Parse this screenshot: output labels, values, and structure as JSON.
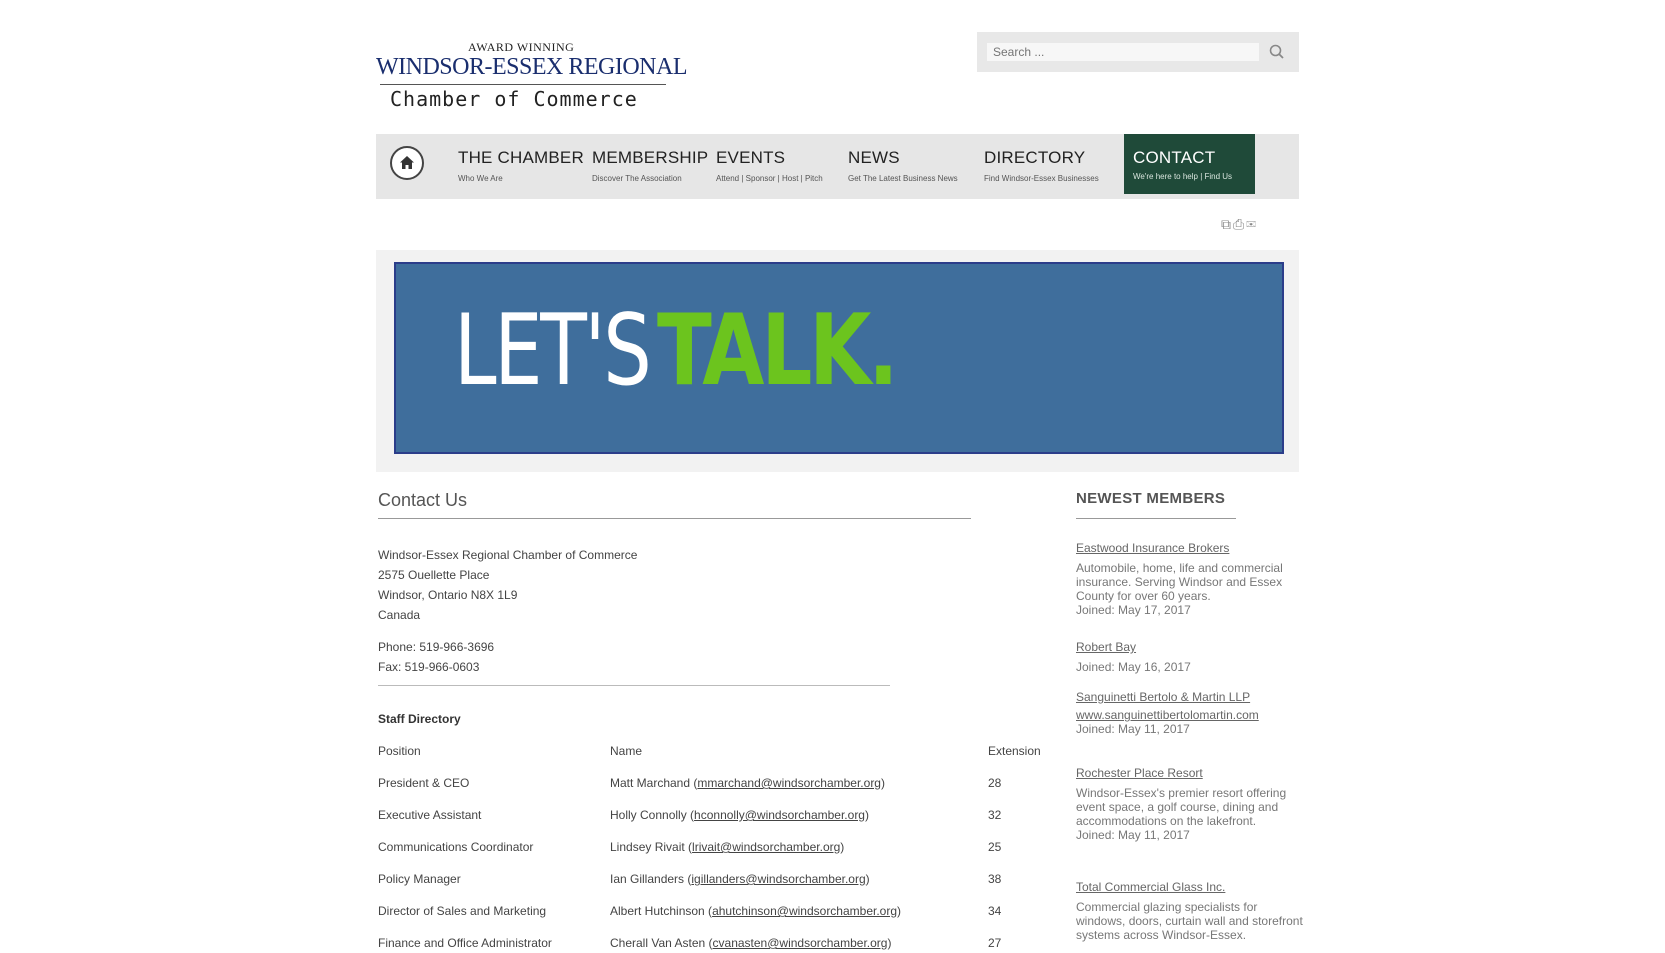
{
  "logo": {
    "award": "AWARD WINNING",
    "main": "WINDSOR-ESSEX REGIONAL",
    "sub": "Chamber of Commerce"
  },
  "search": {
    "placeholder": "Search ..."
  },
  "nav": {
    "items": [
      {
        "label": "THE CHAMBER",
        "sub": "Who We Are"
      },
      {
        "label": "MEMBERSHIP",
        "sub": "Discover The Association"
      },
      {
        "label": "EVENTS",
        "sub": "Attend | Sponsor | Host | Pitch"
      },
      {
        "label": "NEWS",
        "sub": "Get The Latest Business News"
      },
      {
        "label": "DIRECTORY",
        "sub": "Find Windsor-Essex Businesses"
      },
      {
        "label": "CONTACT",
        "sub": "We're here to help | Find Us"
      }
    ]
  },
  "banner": {
    "lets": "LET'S",
    "talk": "TALK."
  },
  "main": {
    "title": "Contact Us",
    "address": [
      "Windsor-Essex Regional Chamber of Commerce",
      "2575 Ouellette Place",
      "Windsor, Ontario N8X 1L9",
      "Canada"
    ],
    "phone": "Phone: 519-966-3696",
    "fax": "Fax: 519-966-0603",
    "staff_heading": "Staff Directory",
    "columns": [
      "Position",
      "Name",
      "Extension"
    ],
    "staff": [
      {
        "position": "President & CEO",
        "name": "Matt Marchand",
        "email": "mmarchand@windsorchamber.org",
        "ext": "28"
      },
      {
        "position": "Executive Assistant",
        "name": "Holly Connolly",
        "email": "hconnolly@windsorchamber.org",
        "ext": "32"
      },
      {
        "position": "Communications Coordinator",
        "name": "Lindsey Rivait",
        "email": "lrivait@windsorchamber.org",
        "ext": "25"
      },
      {
        "position": "Policy Manager",
        "name": "Ian Gillanders",
        "email": "igillanders@windsorchamber.org",
        "ext": "38"
      },
      {
        "position": "Director of Sales and Marketing",
        "name": "Albert Hutchinson",
        "email": "ahutchinson@windsorchamber.org",
        "ext": "34"
      },
      {
        "position": "Finance and Office Administrator",
        "name": "Cherall Van Asten",
        "email": "cvanasten@windsorchamber.org",
        "ext": "27"
      }
    ]
  },
  "sidebar": {
    "title": "NEWEST MEMBERS",
    "members": [
      {
        "name": "Eastwood Insurance Brokers",
        "desc": "Automobile, home, life and commercial insurance. Serving Windsor and Essex County for over 60 years.",
        "joined": "Joined: May 17, 2017"
      },
      {
        "name": "Robert Bay",
        "desc": "",
        "joined": "Joined: May 16, 2017"
      },
      {
        "name": "Sanguinetti Bertolo & Martin LLP",
        "desc": "www.sanguinettibertolomartin.com",
        "joined": "Joined: May 11, 2017"
      },
      {
        "name": "Rochester Place Resort",
        "desc": "Windsor-Essex's premier resort offering event space, a golf course, dining and accommodations on the lakefront.",
        "joined": "Joined: May 11, 2017"
      },
      {
        "name": "Total Commercial Glass Inc.",
        "desc": "Commercial glazing specialists for windows, doors, curtain wall and storefront systems across Windsor-Essex.",
        "joined": ""
      }
    ]
  },
  "colors": {
    "nav_active": "#1f4a39",
    "banner_bg": "#3f6e9c",
    "banner_accent": "#6cc41e",
    "logo_blue": "#1a2e6e"
  },
  "icons": [
    "search-icon",
    "home-icon",
    "share-icon",
    "print-icon",
    "email-icon"
  ]
}
